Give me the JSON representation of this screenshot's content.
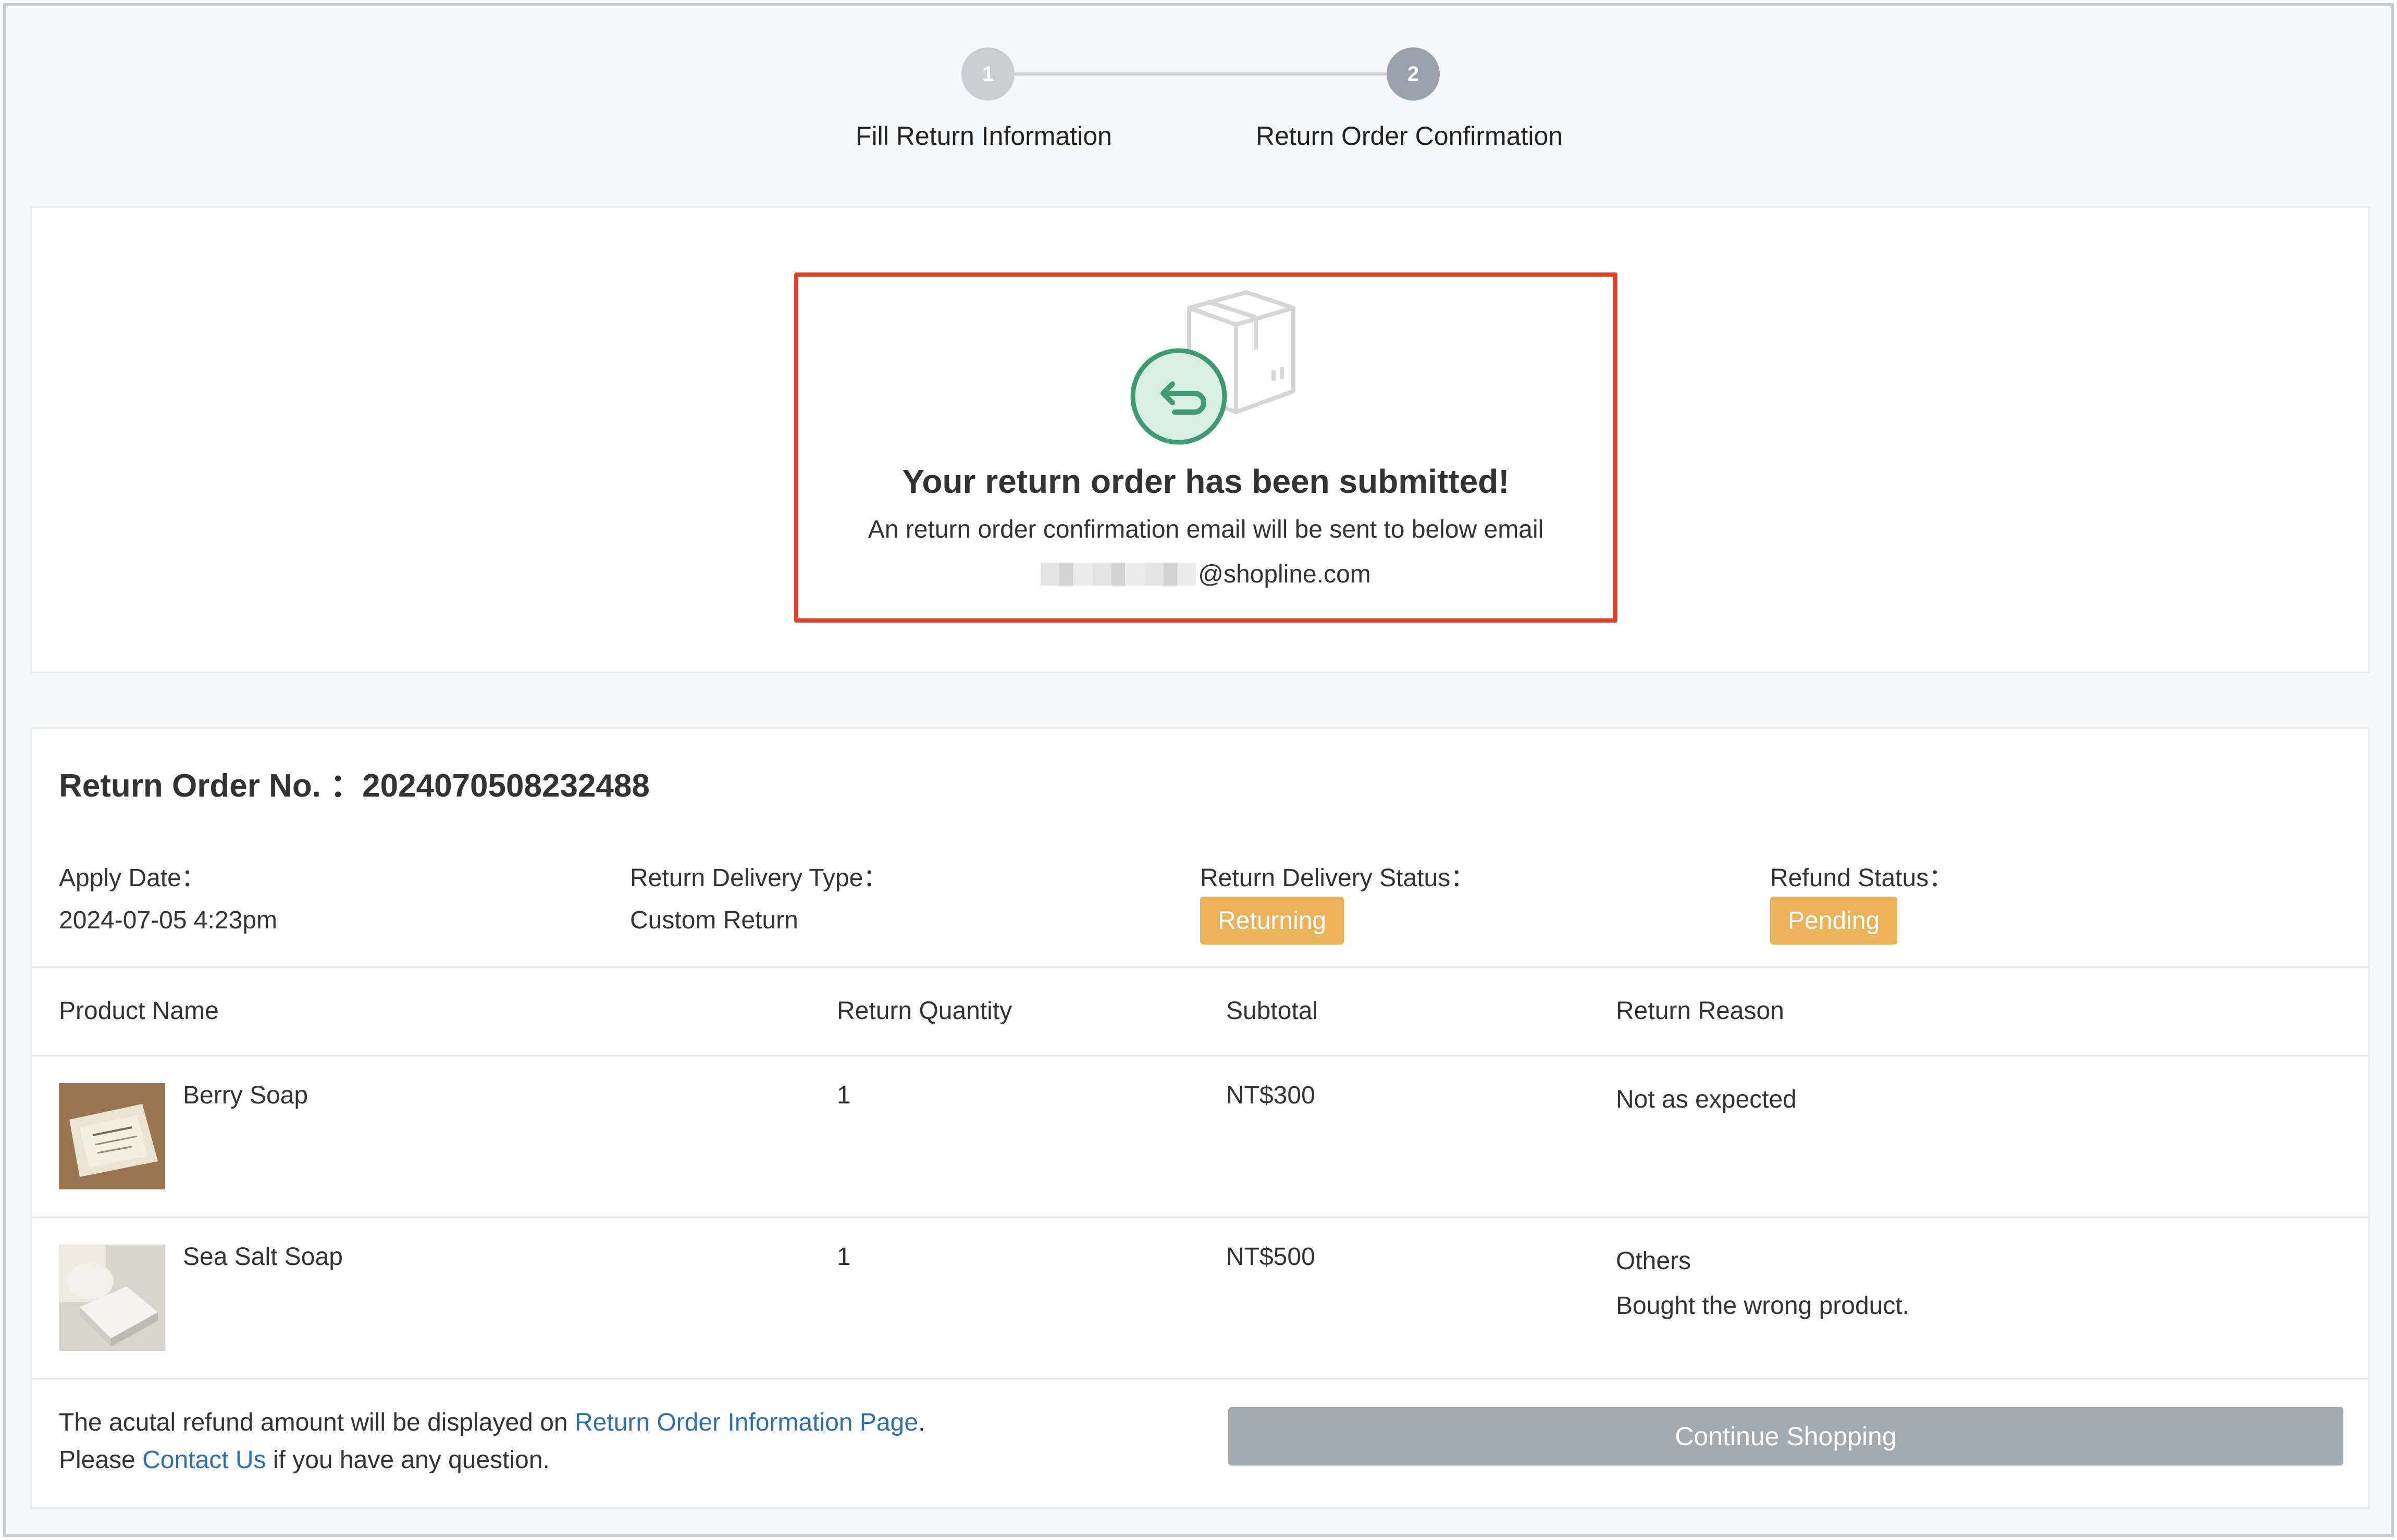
{
  "stepper": {
    "steps": [
      {
        "number": "1",
        "label": "Fill Return Information"
      },
      {
        "number": "2",
        "label": "Return Order Confirmation"
      }
    ]
  },
  "confirmation": {
    "title": "Your return order has been submitted!",
    "description": "An return order confirmation email will be sent to below email",
    "email_domain": "@shopline.com"
  },
  "order": {
    "number_label": "Return Order No. ：2024070508232488",
    "apply_date_label": "Apply Date：",
    "apply_date": "2024-07-05 4:23pm",
    "delivery_type_label": "Return Delivery Type：",
    "delivery_type": "Custom Return",
    "delivery_status_label": "Return Delivery Status：",
    "delivery_status": "Returning",
    "refund_status_label": "Refund Status：",
    "refund_status": "Pending",
    "status_color": "#eab25a"
  },
  "table": {
    "headers": [
      "Product Name",
      "Return Quantity",
      "Subtotal",
      "Return Reason"
    ],
    "rows": [
      {
        "name": "Berry Soap",
        "quantity": "1",
        "subtotal": "NT$300",
        "reason": "Not as expected",
        "reason_note": ""
      },
      {
        "name": "Sea Salt Soap",
        "quantity": "1",
        "subtotal": "NT$500",
        "reason": "Others",
        "reason_note": "Bought the wrong product."
      }
    ]
  },
  "footer": {
    "line1_prefix": "The acutal refund amount will be displayed on ",
    "line1_link": "Return Order Information Page",
    "line1_suffix": ".",
    "line2_prefix": "Please ",
    "line2_link": "Contact Us",
    "line2_suffix": " if you have any question.",
    "continue_label": "Continue Shopping"
  },
  "colors": {
    "highlight_border": "#e0402a",
    "link": "#2f6fb0",
    "button": "#a3abb2",
    "return_icon": "#3f9a72"
  }
}
